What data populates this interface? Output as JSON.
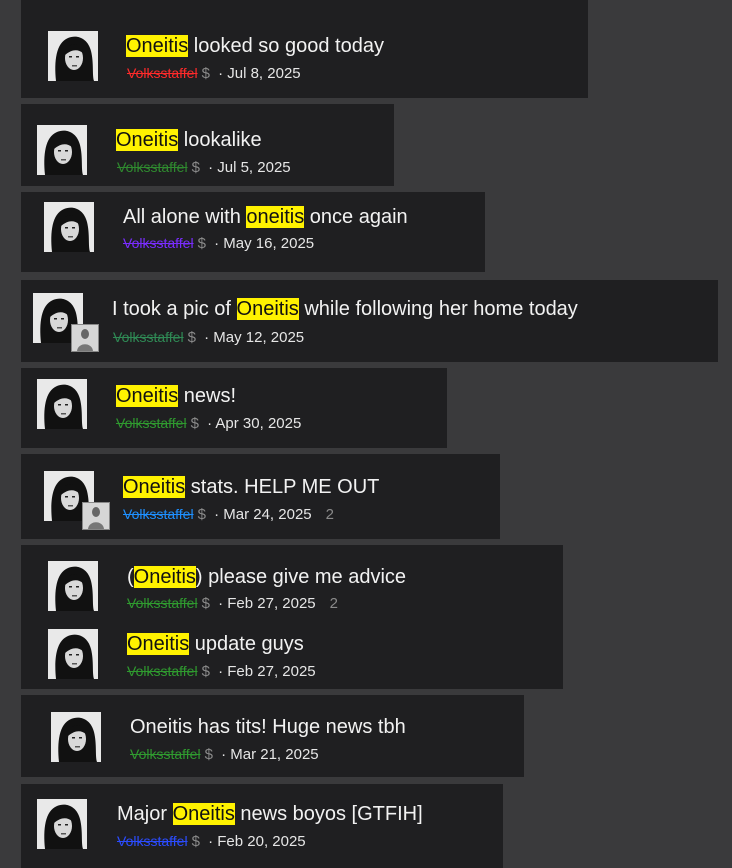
{
  "threads": [
    {
      "pre": "",
      "hl": "Oneitis",
      "post": " looked so good today",
      "author": "Volksstaffel",
      "author_color": "#ff2a2a",
      "date": "Jul 8, 2025",
      "count": ""
    },
    {
      "pre": "",
      "hl": "Oneitis",
      "post": " lookalike",
      "author": "Volksstaffel",
      "author_color": "#2f8a2f",
      "date": "Jul 5, 2025",
      "count": ""
    },
    {
      "pre": "All alone with ",
      "hl": "oneitis",
      "post": " once again",
      "author": "Volksstaffel",
      "author_color": "#7a2cff",
      "date": "May 16, 2025",
      "count": ""
    },
    {
      "pre": "I took a pic of ",
      "hl": "Oneitis",
      "post": " while following her home today",
      "author": "Volksstaffel",
      "author_color": "#2f8a55",
      "date": "May 12, 2025",
      "count": ""
    },
    {
      "pre": "",
      "hl": "Oneitis",
      "post": " news!",
      "author": "Volksstaffel",
      "author_color": "#2f9a2f",
      "date": "Apr 30, 2025",
      "count": ""
    },
    {
      "pre": "",
      "hl": "Oneitis",
      "post": " stats. HELP ME OUT",
      "author": "Volksstaffel",
      "author_color": "#1e90ff",
      "date": "Mar 24, 2025",
      "count": "2"
    },
    {
      "pre": "(",
      "hl": "Oneitis",
      "post": ") please give me advice",
      "author": "Volksstaffel",
      "author_color": "#2f9a2f",
      "date": "Feb 27, 2025",
      "count": "2"
    },
    {
      "pre": "",
      "hl": "Oneitis",
      "post": " update guys",
      "author": "Volksstaffel",
      "author_color": "#2f9a2f",
      "date": "Feb 27, 2025",
      "count": ""
    },
    {
      "pre": "Oneitis has tits! Huge news tbh",
      "hl": "",
      "post": "",
      "author": "Volksstaffel",
      "author_color": "#2f9a2f",
      "date": "Mar 21, 2025",
      "count": ""
    },
    {
      "pre": "Major ",
      "hl": "Oneitis",
      "post": " news boyos [GTFIH]",
      "author": "Volksstaffel",
      "author_color": "#2b4cff",
      "date": "Feb 20, 2025",
      "count": ""
    }
  ],
  "top_partial": {
    "date": "Jul 8, 2025"
  },
  "icons": {
    "avatar": "portrait-avatar-icon",
    "currency": "dollar-sign-icon"
  },
  "separator": " · "
}
